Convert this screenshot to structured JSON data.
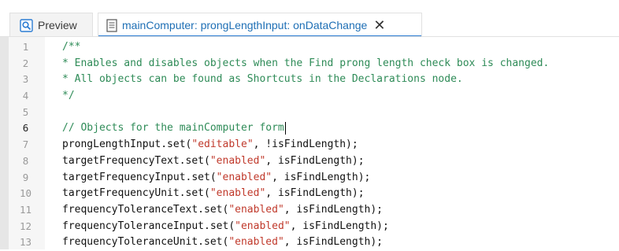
{
  "tabs": [
    {
      "label": "Preview",
      "icon": "preview-search-icon",
      "active": false
    },
    {
      "label": "mainComputer: prongLengthInput: onDataChange",
      "icon": "script-document-icon",
      "active": true,
      "close_symbol": "✕"
    }
  ],
  "colors": {
    "comment": "#2e8b57",
    "string": "#c0392b",
    "tab_active_text": "#1e6fb5",
    "tab_accent": "#2b7cd3"
  },
  "editor": {
    "current_line": 6,
    "lines": [
      {
        "num": "1",
        "parts": [
          {
            "t": "/**",
            "k": "comment"
          }
        ]
      },
      {
        "num": "2",
        "parts": [
          {
            "t": "* Enables and disables objects when the Find prong length check box is changed.",
            "k": "comment"
          }
        ]
      },
      {
        "num": "3",
        "parts": [
          {
            "t": "* All objects can be found as Shortcuts in the Declarations node.",
            "k": "comment"
          }
        ]
      },
      {
        "num": "4",
        "parts": [
          {
            "t": "*/",
            "k": "comment"
          }
        ]
      },
      {
        "num": "5",
        "parts": []
      },
      {
        "num": "6",
        "parts": [
          {
            "t": "// Objects for the mainComputer form",
            "k": "comment"
          }
        ]
      },
      {
        "num": "7",
        "parts": [
          {
            "t": "prongLengthInput.set(",
            "k": "code"
          },
          {
            "t": "\"editable\"",
            "k": "str"
          },
          {
            "t": ", !isFindLength);",
            "k": "code"
          }
        ]
      },
      {
        "num": "8",
        "parts": [
          {
            "t": "targetFrequencyText.set(",
            "k": "code"
          },
          {
            "t": "\"enabled\"",
            "k": "str"
          },
          {
            "t": ", isFindLength);",
            "k": "code"
          }
        ]
      },
      {
        "num": "9",
        "parts": [
          {
            "t": "targetFrequencyInput.set(",
            "k": "code"
          },
          {
            "t": "\"enabled\"",
            "k": "str"
          },
          {
            "t": ", isFindLength);",
            "k": "code"
          }
        ]
      },
      {
        "num": "10",
        "parts": [
          {
            "t": "targetFrequencyUnit.set(",
            "k": "code"
          },
          {
            "t": "\"enabled\"",
            "k": "str"
          },
          {
            "t": ", isFindLength);",
            "k": "code"
          }
        ]
      },
      {
        "num": "11",
        "parts": [
          {
            "t": "frequencyToleranceText.set(",
            "k": "code"
          },
          {
            "t": "\"enabled\"",
            "k": "str"
          },
          {
            "t": ", isFindLength);",
            "k": "code"
          }
        ]
      },
      {
        "num": "12",
        "parts": [
          {
            "t": "frequencyToleranceInput.set(",
            "k": "code"
          },
          {
            "t": "\"enabled\"",
            "k": "str"
          },
          {
            "t": ", isFindLength);",
            "k": "code"
          }
        ]
      },
      {
        "num": "13",
        "parts": [
          {
            "t": "frequencyToleranceUnit.set(",
            "k": "code"
          },
          {
            "t": "\"enabled\"",
            "k": "str"
          },
          {
            "t": ", isFindLength);",
            "k": "code"
          }
        ]
      }
    ]
  }
}
